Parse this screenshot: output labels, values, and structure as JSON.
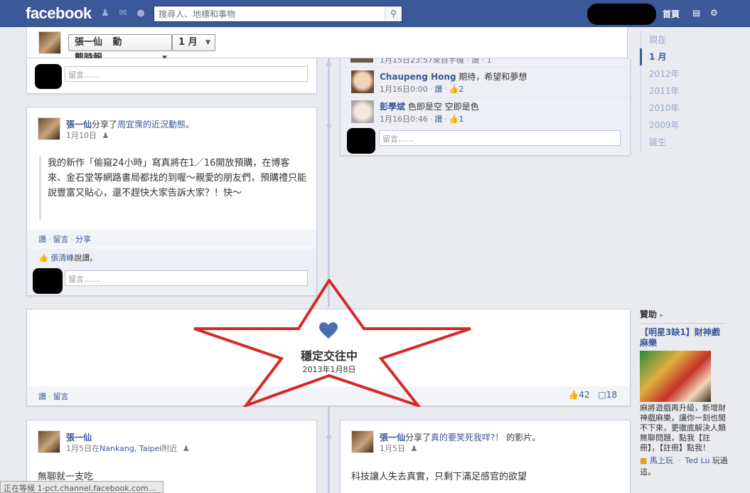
{
  "header": {
    "logo": "facebook",
    "search_placeholder": "搜尋人、地標和事物",
    "home": "首頁"
  },
  "timeline_header": {
    "name": "張一仙",
    "view": "動態時報",
    "month": "1 月"
  },
  "scrubber": [
    "現在",
    "1 月",
    "2012年",
    "2011年",
    "2010年",
    "2009年",
    "誕生"
  ],
  "comment_placeholder": "留言……",
  "post1": {
    "author": "張一仙",
    "share_text": "分享了",
    "shared_link": "周宜霈的近況動態",
    "date": "1月10日",
    "quote": "我的新作「偷窺24小時」寫真將在1／16開放預購，在博客來、金石堂等網路書局都找的到喔～親愛的朋友們，預購禮只能說豐富又貼心，還不趕快大家告訴大家？！快～",
    "actions": [
      "讚",
      "留言",
      "分享"
    ],
    "liker": "張清峰",
    "liked_text": "說讚。"
  },
  "comments": {
    "partial_top": "1月15日23:57來自手機 · 讚 · 1",
    "c1": {
      "name": "Chaupeng Hong",
      "text": "期待，希望和夢想",
      "date": "1月16日0:00",
      "like": "讚",
      "count": "2"
    },
    "c2": {
      "name": "彭學斌",
      "text": "色即是空 空即是色",
      "date": "1月16日0:46",
      "like": "讚",
      "count": "1"
    }
  },
  "life_event": {
    "title": "穩定交往中",
    "date": "2013年1月8日",
    "actions": [
      "讚",
      "留言"
    ],
    "likes": "42",
    "comments": "18"
  },
  "post2": {
    "author": "張一仙",
    "date": "1月5日在",
    "place": "Nankang, Taipei",
    "near": "附近",
    "text": "無聊就一支吃"
  },
  "post3": {
    "author": "張一仙",
    "share_text": "分享了",
    "shared_link": "真的要笑死我咩?！",
    "suffix": "的影片。",
    "date": "1月5日",
    "text": "科技讓人失去真實，只剩下滿足感官的欲望"
  },
  "sponsor": {
    "heading": "贊助",
    "title": "【明星3缺1】財神戲麻樂",
    "body": "麻將遊戲再升級，新增財神戲麻樂，讓你一刻也閒不下來，更徹底解決人類無聊問題，點我【註冊】，【註冊】點我！",
    "action": "馬上玩",
    "friend": "Ted Lu",
    "friend_text": "玩過這。"
  },
  "status_bar": "正在等候 1-pct.channel.facebook.com...",
  "colors": {
    "brand": "#3b5998",
    "star": "#d42a2a",
    "heart": "#4a6cb0"
  }
}
